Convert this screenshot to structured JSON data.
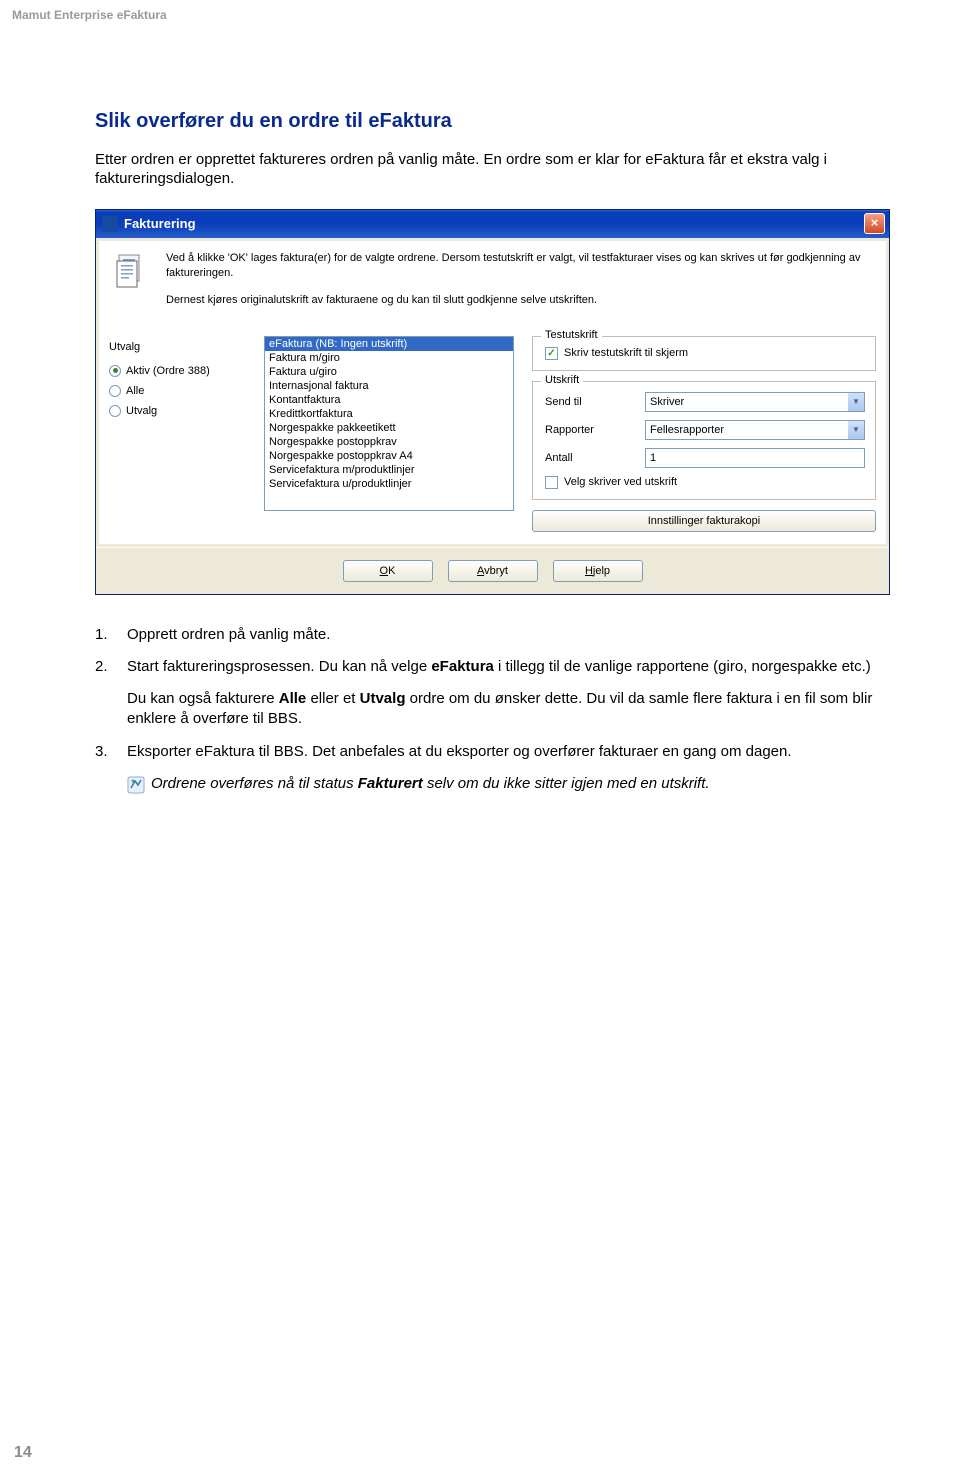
{
  "header": "Mamut Enterprise eFaktura",
  "section_title": "Slik overfører du en ordre til eFaktura",
  "intro": "Etter ordren er opprettet faktureres ordren på vanlig måte. En ordre som er klar for eFaktura får et ekstra valg i faktureringsdialogen.",
  "dialog": {
    "title": "Fakturering",
    "info1": "Ved å klikke 'OK' lages faktura(er) for de valgte ordrene. Dersom testutskrift er valgt, vil testfakturaer vises og kan skrives ut før godkjenning av faktureringen.",
    "info2": "Dernest kjøres originalutskrift av fakturaene og du kan til slutt godkjenne selve utskriften.",
    "utvalg_label": "Utvalg",
    "radios": {
      "aktiv": "Aktiv (Ordre 388)",
      "alle": "Alle",
      "utvalg": "Utvalg"
    },
    "list_items": [
      "eFaktura (NB: Ingen utskrift)",
      "Faktura m/giro",
      "Faktura u/giro",
      "Internasjonal faktura",
      "Kontantfaktura",
      "Kredittkortfaktura",
      "Norgespakke pakkeetikett",
      "Norgespakke postoppkrav",
      "Norgespakke postoppkrav A4",
      "Servicefaktura m/produktlinjer",
      "Servicefaktura u/produktlinjer"
    ],
    "testutskrift_legend": "Testutskrift",
    "testutskrift_cb": "Skriv testutskrift til skjerm",
    "utskrift_legend": "Utskrift",
    "sendtil_label": "Send til",
    "sendtil_value": "Skriver",
    "rapporter_label": "Rapporter",
    "rapporter_value": "Fellesrapporter",
    "antall_label": "Antall",
    "antall_value": "1",
    "velg_skriver_cb": "Velg skriver ved utskrift",
    "innstillinger_btn": "Innstillinger fakturakopi",
    "ok_btn": "OK",
    "avbryt_btn": "Avbryt",
    "hjelp_btn": "Hjelp"
  },
  "steps": {
    "s1": "Opprett ordren på vanlig måte.",
    "s2_pre": "Start faktureringsprosessen. Du kan nå velge ",
    "s2_bold": "eFaktura",
    "s2_post": " i tillegg til de vanlige rapportene (giro, norgespakke etc.)",
    "indent_pre": "Du kan også fakturere ",
    "indent_b1": "Alle",
    "indent_mid": " eller et ",
    "indent_b2": "Utvalg",
    "indent_post": " ordre om du ønsker dette. Du vil da samle flere faktura i en fil som blir enklere å overføre til BBS.",
    "s3": "Eksporter eFaktura til BBS. Det anbefales at du eksporter og overfører fakturaer en gang om dagen.",
    "note_pre": "Ordrene overføres nå til status ",
    "note_bold": "Fakturert",
    "note_post": " selv om du ikke sitter igjen med en utskrift."
  },
  "page_number": "14"
}
